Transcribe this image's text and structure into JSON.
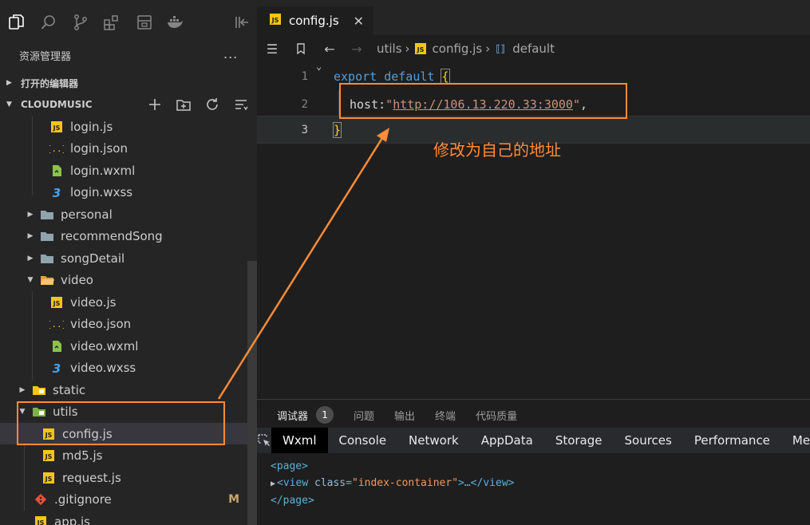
{
  "sidebar": {
    "title": "资源管理器",
    "more": "...",
    "open_editors": "打开的编辑器",
    "project": "CLOUDMUSIC",
    "tree": [
      {
        "label": "login.js",
        "kind": "js"
      },
      {
        "label": "login.json",
        "kind": "json"
      },
      {
        "label": "login.wxml",
        "kind": "wxml"
      },
      {
        "label": "login.wxss",
        "kind": "wxss"
      },
      {
        "label": "personal",
        "kind": "folder"
      },
      {
        "label": "recommendSong",
        "kind": "folder"
      },
      {
        "label": "songDetail",
        "kind": "folder"
      },
      {
        "label": "video",
        "kind": "folder-open"
      },
      {
        "label": "video.js",
        "kind": "js"
      },
      {
        "label": "video.json",
        "kind": "json"
      },
      {
        "label": "video.wxml",
        "kind": "wxml"
      },
      {
        "label": "video.wxss",
        "kind": "wxss"
      },
      {
        "label": "static",
        "kind": "folder-yellow"
      },
      {
        "label": "utils",
        "kind": "folder-green-open"
      },
      {
        "label": "config.js",
        "kind": "js"
      },
      {
        "label": "md5.js",
        "kind": "js"
      },
      {
        "label": "request.js",
        "kind": "js"
      },
      {
        "label": ".gitignore",
        "kind": "git",
        "badge": "M"
      },
      {
        "label": "app.js",
        "kind": "js"
      }
    ]
  },
  "editor": {
    "tab_label": "config.js",
    "tab_close": "✕",
    "breadcrumb": {
      "folder": "utils",
      "file": "config.js",
      "symbol": "default"
    },
    "lines": [
      {
        "number": "1",
        "kw1": "export",
        "kw2": "default",
        "brace": "{"
      },
      {
        "number": "2",
        "key": "host",
        "colon": ":",
        "quote_open": "\"",
        "url": "http://106.13.220.33:3000",
        "quote_close": "\"",
        "comma": ","
      },
      {
        "number": "3",
        "brace": "}"
      }
    ],
    "annotation": "修改为自己的地址"
  },
  "panel": {
    "tabs": [
      {
        "label": "调试器",
        "badge": "1"
      },
      {
        "label": "问题"
      },
      {
        "label": "输出"
      },
      {
        "label": "终端"
      },
      {
        "label": "代码质量"
      }
    ],
    "devtools_tabs": [
      "Wxml",
      "Console",
      "Network",
      "AppData",
      "Storage",
      "Sources",
      "Performance",
      "Mem"
    ],
    "dom": {
      "line1": "<page>",
      "line2_open": "<view ",
      "line2_attr": "class",
      "line2_eq": "=",
      "line2_val": "\"index-container\"",
      "line2_close": ">…</view>",
      "line3": "</page>"
    }
  },
  "colors": {
    "annotation": "#ff8c38",
    "keyword": "#569cd6",
    "string": "#ce9178",
    "sidebar_bg": "#252526",
    "editor_bg": "#1e1e1e"
  }
}
